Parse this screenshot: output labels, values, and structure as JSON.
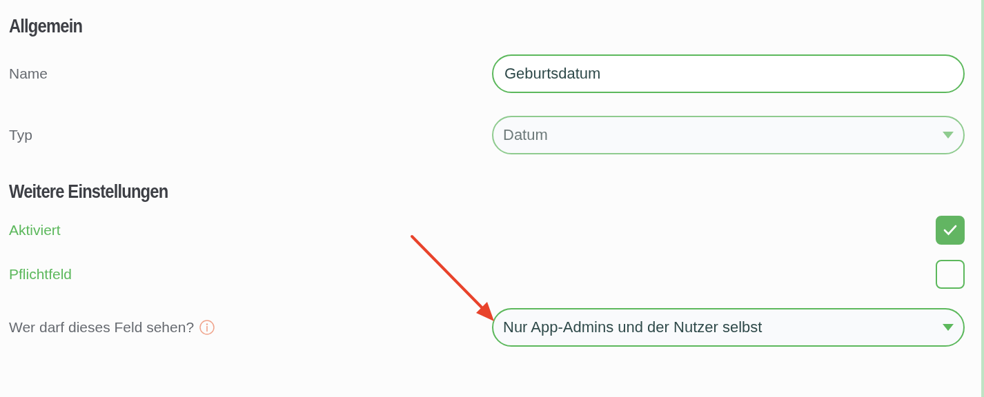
{
  "sections": [
    {
      "title": "Allgemein",
      "rows": [
        {
          "kind": "text-field",
          "label": "Name",
          "value": "Geburtsdatum"
        },
        {
          "kind": "select",
          "label": "Typ",
          "value": "Datum",
          "disabled": true
        }
      ]
    },
    {
      "title": "Weitere Einstellungen",
      "rows": [
        {
          "kind": "checkbox",
          "label": "Aktiviert",
          "checked": true
        },
        {
          "kind": "checkbox",
          "label": "Pflichtfeld",
          "checked": false
        },
        {
          "kind": "select",
          "label": "Wer darf dieses Feld sehen?",
          "value": "Nur App-Admins und der Nutzer selbst",
          "disabled": false,
          "info": true
        }
      ]
    }
  ]
}
